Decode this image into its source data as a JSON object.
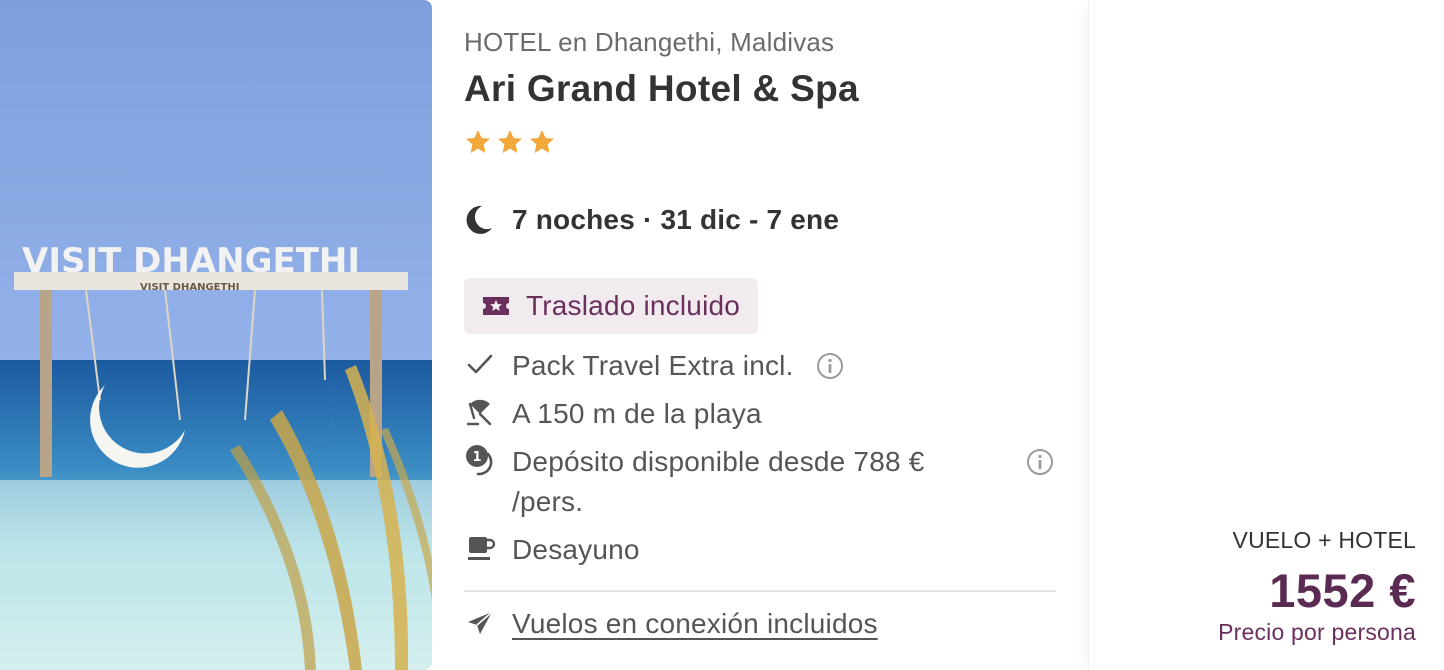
{
  "photo": {
    "sign_text": "VISIT DHANGETHI",
    "sign_subtext": "VISIT DHANGETHI"
  },
  "hotel": {
    "type_location": "HOTEL en Dhangethi, Maldivas",
    "name": "Ari Grand Hotel & Spa",
    "stars": 3,
    "star_color": "#f0a83a"
  },
  "stay": {
    "icon": "moon-icon",
    "dates": "7 noches · 31 dic - 7 ene"
  },
  "badge": {
    "icon": "ticket-icon",
    "label": "Traslado incluido",
    "bg_color": "#f1ebf0",
    "text_color": "#6b2f5d"
  },
  "features": [
    {
      "icon": "check-icon",
      "label": "Pack Travel Extra incl.",
      "has_info": true
    },
    {
      "icon": "beach-umbrella-icon",
      "label": "A 150 m de la playa",
      "has_info": false
    },
    {
      "icon": "deposit-clock-icon",
      "label": "Depósito disponible desde 788 € /pers.",
      "has_info": true
    },
    {
      "icon": "coffee-cup-icon",
      "label": "Desayuno",
      "has_info": false
    }
  ],
  "flights": {
    "icon": "airplane-icon",
    "link_label": "Vuelos en conexión incluidos"
  },
  "price": {
    "label": "VUELO + HOTEL",
    "value": "1552 €",
    "note": "Precio por persona",
    "accent_color": "#5b2a52"
  }
}
